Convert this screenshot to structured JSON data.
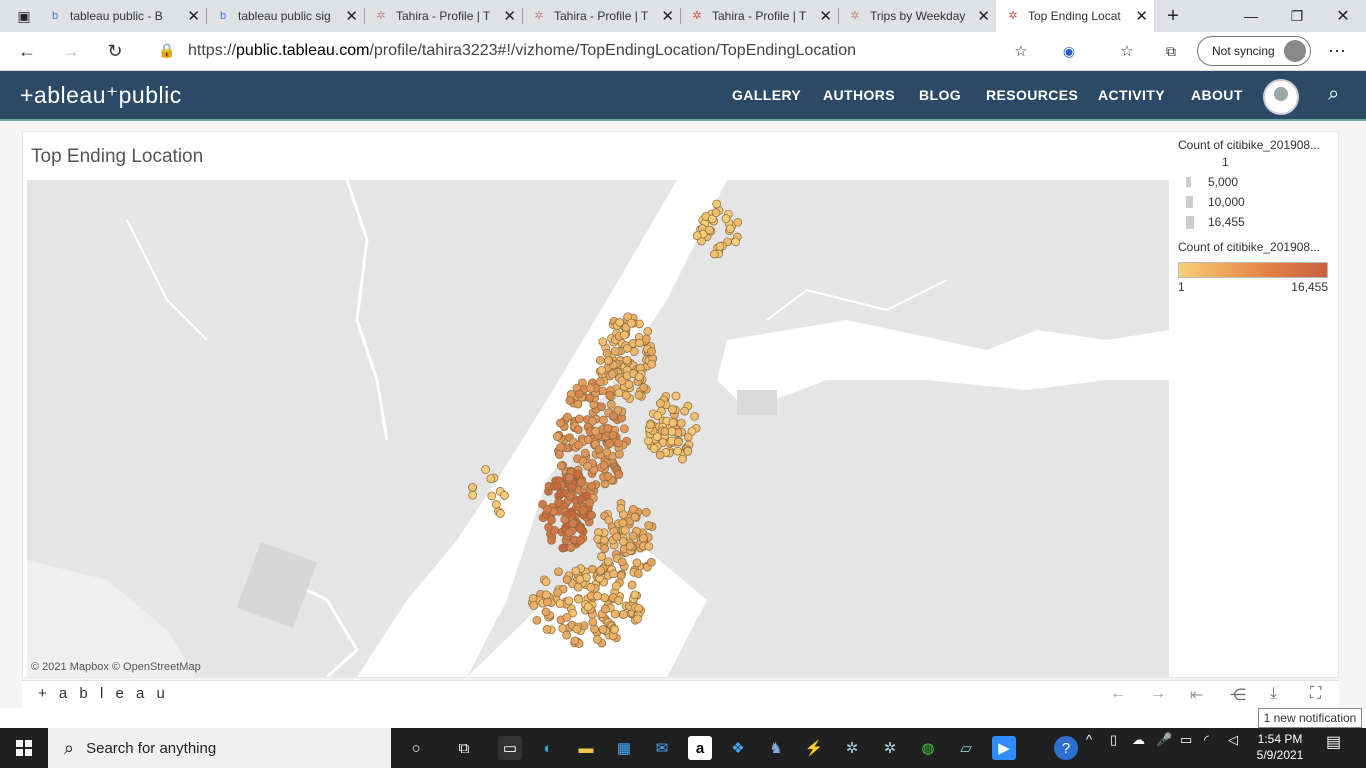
{
  "browser": {
    "tabs": [
      {
        "title": "tableau public - B",
        "icon": "bing-icon"
      },
      {
        "title": "tableau public sig",
        "icon": "bing-icon"
      },
      {
        "title": "Tahira - Profile | T",
        "icon": "tableau-icon"
      },
      {
        "title": "Tahira - Profile | T",
        "icon": "tableau-icon"
      },
      {
        "title": "Tahira - Profile | T",
        "icon": "tableau-icon"
      },
      {
        "title": "Trips by Weekday",
        "icon": "tableau-icon"
      },
      {
        "title": "Top Ending Locat",
        "icon": "tableau-icon"
      }
    ],
    "url_prefix": "https://",
    "url_domain": "public.tableau.com",
    "url_path": "/profile/tahira3223#!/vizhome/TopEndingLocation/TopEndingLocation",
    "sync_label": "Not syncing"
  },
  "site": {
    "logo": "+ableau⁺public",
    "nav": [
      "GALLERY",
      "AUTHORS",
      "BLOG",
      "RESOURCES",
      "ACTIVITY",
      "ABOUT"
    ]
  },
  "viz": {
    "title": "Top Ending Location",
    "attribution": "© 2021 Mapbox  © OpenStreetMap",
    "size_legend_title": "Count of citibike_201908...",
    "size_legend": [
      "1",
      "5,000",
      "10,000",
      "16,455"
    ],
    "color_legend_title": "Count of citibike_201908...",
    "color_min": "1",
    "color_max": "16,455",
    "color_low": "#f6cf7a",
    "color_high": "#c9623e"
  },
  "footer": {
    "logo": "+ a b l e a u"
  },
  "notification": "1 new notification",
  "taskbar": {
    "search_placeholder": "Search for anything",
    "time": "1:54 PM",
    "date": "5/9/2021"
  }
}
